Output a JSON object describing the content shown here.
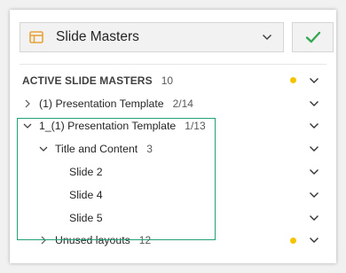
{
  "dropdown": {
    "label": "Slide Masters",
    "icon": "slide-master-icon"
  },
  "confirm": {
    "icon": "checkmark-icon",
    "color": "#33a852"
  },
  "highlight_color": "#21a07a",
  "indicator_color": "#f5c400",
  "tree": {
    "header": {
      "label": "ACTIVE SLIDE MASTERS",
      "count": "10"
    },
    "rows": [
      {
        "label": "(1) Presentation Template",
        "count": "2/14"
      },
      {
        "label": "1_(1) Presentation Template",
        "count": "1/13"
      },
      {
        "label": "Title and Content",
        "count": "3"
      },
      {
        "label": "Slide 2"
      },
      {
        "label": "Slide 4"
      },
      {
        "label": "Slide 5"
      },
      {
        "label": "Unused layouts",
        "count": "12"
      }
    ]
  }
}
